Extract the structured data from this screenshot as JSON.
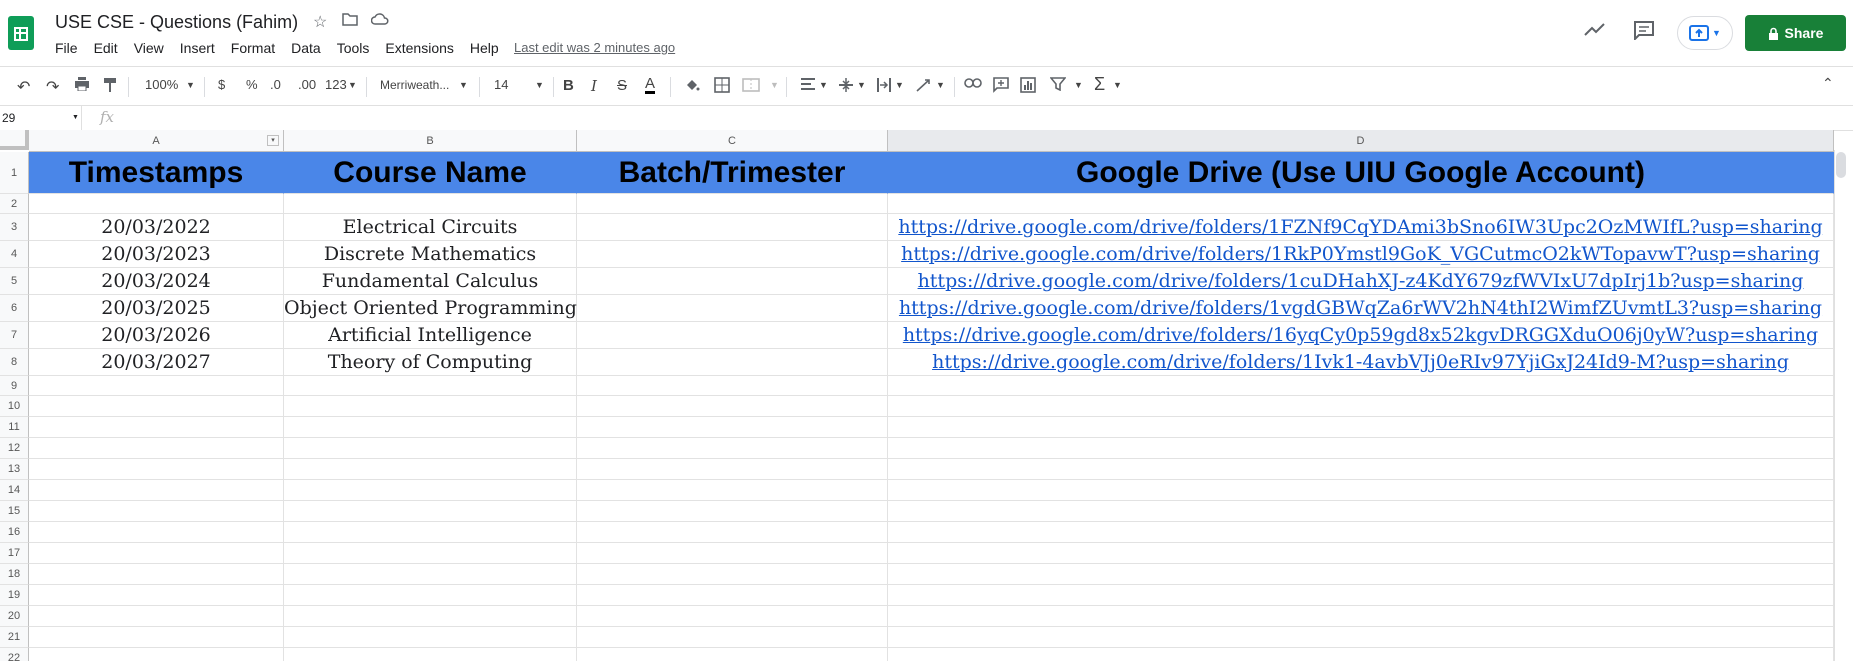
{
  "doc": {
    "title": "USE CSE - Questions (Fahim)",
    "last_edit": "Last edit was 2 minutes ago"
  },
  "menu": [
    "File",
    "Edit",
    "View",
    "Insert",
    "Format",
    "Data",
    "Tools",
    "Extensions",
    "Help"
  ],
  "share": {
    "label": "Share"
  },
  "toolbar": {
    "zoom": "100%",
    "currency": "$",
    "percent": "%",
    "decimal_less": ".0",
    "decimal_more": ".00",
    "format_more": "123",
    "font": "Merriweath...",
    "font_size": "14"
  },
  "formula_bar": {
    "name_box": "29",
    "fx": "fx"
  },
  "columns": [
    "A",
    "B",
    "C",
    "D"
  ],
  "rows": [
    "1",
    "2",
    "3",
    "4",
    "5",
    "6",
    "7",
    "8",
    "9",
    "10",
    "11",
    "12",
    "13",
    "14",
    "15",
    "16",
    "17",
    "18",
    "19",
    "20",
    "21",
    "22"
  ],
  "header_row": [
    "Timestamps",
    "Course Name",
    "Batch/Trimester",
    "Google Drive (Use UIU Google Account)"
  ],
  "data_rows": [
    [
      "20/03/2022",
      "Electrical Circuits",
      "",
      "https://drive.google.com/drive/folders/1FZNf9CqYDAmi3bSno6IW3Upc2OzMWIfL?usp=sharing"
    ],
    [
      "20/03/2023",
      "Discrete Mathematics",
      "",
      "https://drive.google.com/drive/folders/1RkP0Ymstl9GoK_VGCutmcO2kWTopavwT?usp=sharing"
    ],
    [
      "20/03/2024",
      "Fundamental Calculus",
      "",
      "https://drive.google.com/drive/folders/1cuDHahXJ-z4KdY679zfWVIxU7dpIrj1b?usp=sharing"
    ],
    [
      "20/03/2025",
      "Object Oriented Programming",
      "",
      "https://drive.google.com/drive/folders/1vgdGBWqZa6rWV2hN4thI2WimfZUvmtL3?usp=sharing"
    ],
    [
      "20/03/2026",
      "Artificial Intelligence",
      "",
      "https://drive.google.com/drive/folders/16yqCy0p59gd8x52kgvDRGGXduO06j0yW?usp=sharing"
    ],
    [
      "20/03/2027",
      "Theory of Computing",
      "",
      "https://drive.google.com/drive/folders/1Ivk1-4avbVJj0eRIv97YjiGxJ24Id9-M?usp=sharing"
    ]
  ],
  "colors": {
    "header_fill": "#4a86e8",
    "share": "#188038",
    "link": "#1155cc"
  }
}
